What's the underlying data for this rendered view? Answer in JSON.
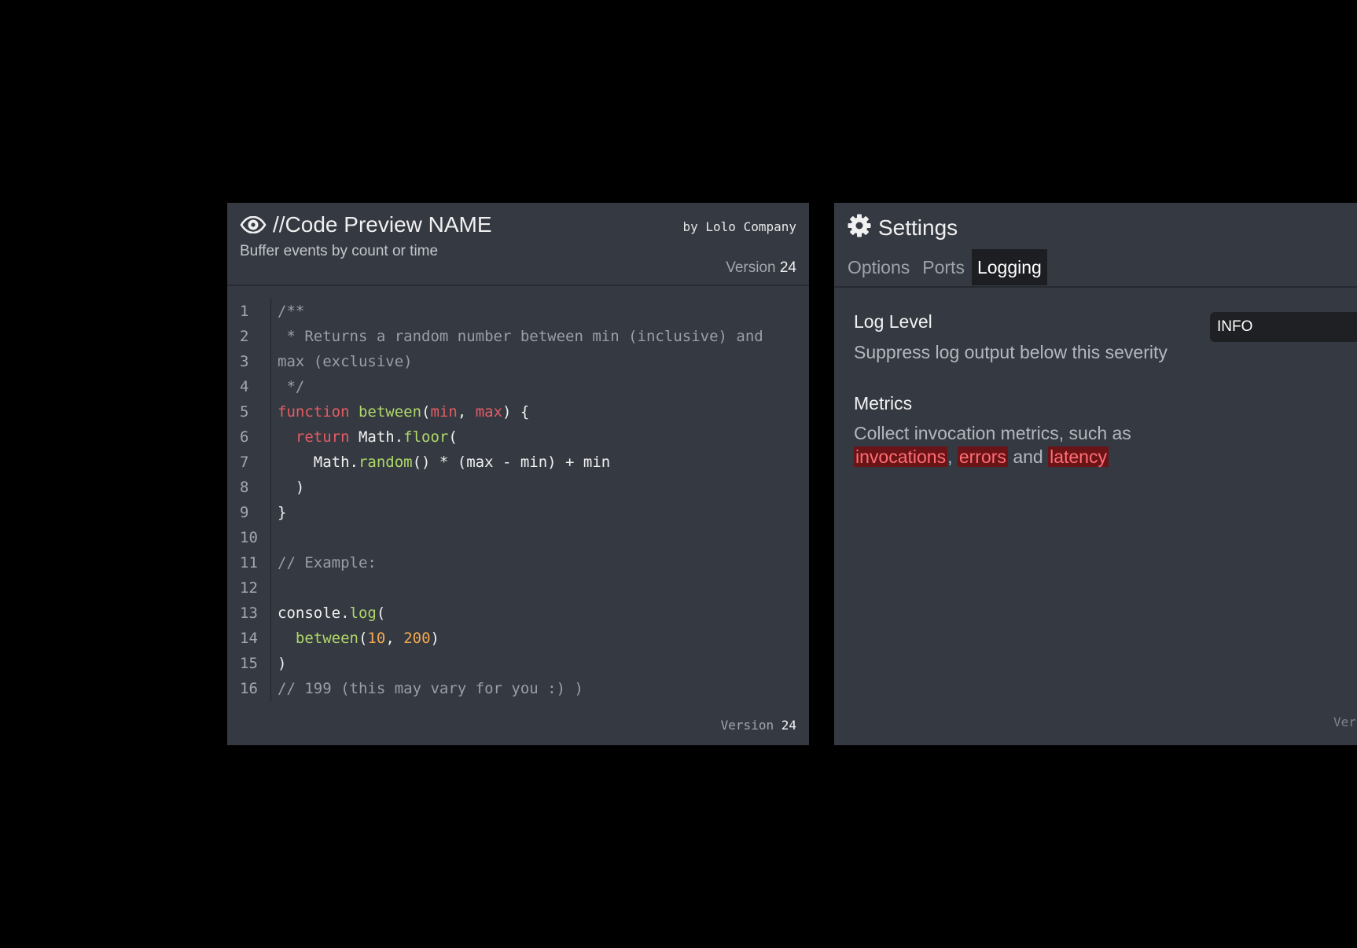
{
  "code_panel": {
    "title": "//Code Preview NAME",
    "subtitle": "Buffer events by count or time",
    "author": "by Lolo Company",
    "version_label": "Version",
    "version_number": "24",
    "icon": "eye-icon",
    "lines": [
      {
        "n": "1",
        "tokens": [
          {
            "t": "/**",
            "c": "comment"
          }
        ]
      },
      {
        "n": "2",
        "tokens": [
          {
            "t": " * Returns a random number between min (inclusive) and",
            "c": "comment"
          }
        ]
      },
      {
        "n": "3",
        "tokens": [
          {
            "t": "max (exclusive)",
            "c": "comment"
          }
        ]
      },
      {
        "n": "4",
        "tokens": [
          {
            "t": " */",
            "c": "comment"
          }
        ]
      },
      {
        "n": "5",
        "tokens": [
          {
            "t": "function",
            "c": "kw"
          },
          {
            "t": " ",
            "c": "plain"
          },
          {
            "t": "between",
            "c": "fn"
          },
          {
            "t": "(",
            "c": "plain"
          },
          {
            "t": "min",
            "c": "kw"
          },
          {
            "t": ", ",
            "c": "plain"
          },
          {
            "t": "max",
            "c": "kw"
          },
          {
            "t": ") {",
            "c": "plain"
          }
        ]
      },
      {
        "n": "6",
        "tokens": [
          {
            "t": "  ",
            "c": "plain"
          },
          {
            "t": "return",
            "c": "kw"
          },
          {
            "t": " Math.",
            "c": "plain"
          },
          {
            "t": "floor",
            "c": "fn"
          },
          {
            "t": "(",
            "c": "plain"
          }
        ]
      },
      {
        "n": "7",
        "tokens": [
          {
            "t": "    Math.",
            "c": "plain"
          },
          {
            "t": "random",
            "c": "fn"
          },
          {
            "t": "() * (max - min) + min",
            "c": "plain"
          }
        ]
      },
      {
        "n": "8",
        "tokens": [
          {
            "t": "  )",
            "c": "plain"
          }
        ]
      },
      {
        "n": "9",
        "tokens": [
          {
            "t": "}",
            "c": "plain"
          }
        ]
      },
      {
        "n": "10",
        "tokens": []
      },
      {
        "n": "11",
        "tokens": [
          {
            "t": "// Example:",
            "c": "comment"
          }
        ]
      },
      {
        "n": "12",
        "tokens": []
      },
      {
        "n": "13",
        "tokens": [
          {
            "t": "console.",
            "c": "plain"
          },
          {
            "t": "log",
            "c": "fn"
          },
          {
            "t": "(",
            "c": "plain"
          }
        ]
      },
      {
        "n": "14",
        "tokens": [
          {
            "t": "  ",
            "c": "plain"
          },
          {
            "t": "between",
            "c": "fn"
          },
          {
            "t": "(",
            "c": "plain"
          },
          {
            "t": "10",
            "c": "num"
          },
          {
            "t": ", ",
            "c": "plain"
          },
          {
            "t": "200",
            "c": "num"
          },
          {
            "t": ")",
            "c": "plain"
          }
        ]
      },
      {
        "n": "15",
        "tokens": [
          {
            "t": ")",
            "c": "plain"
          }
        ]
      },
      {
        "n": "16",
        "tokens": [
          {
            "t": "// 199 (this may vary for you :) )",
            "c": "comment"
          }
        ]
      }
    ]
  },
  "settings_panel": {
    "title": "Settings",
    "icon": "gear-icon",
    "tabs": [
      {
        "label": "Options",
        "active": false
      },
      {
        "label": "Ports",
        "active": false
      },
      {
        "label": "Logging",
        "active": true
      }
    ],
    "log_level": {
      "label": "Log Level",
      "description": "Suppress log output below this severity",
      "value": "INFO"
    },
    "metrics": {
      "label": "Metrics",
      "description_line1": "Collect invocation metrics, such as",
      "item1": "invocations",
      "sep1": ",",
      "item2": "errors",
      "sep2": "and",
      "item3": "latency"
    },
    "version_label": "Ver"
  },
  "colors": {
    "background": "#000000",
    "panel": "#353941",
    "keyword": "#e45c64",
    "function": "#aed86a",
    "number": "#f0aa52",
    "comment": "#9a9ea5",
    "highlight_bg": "#6a1418",
    "highlight_text": "#ff6e73"
  }
}
